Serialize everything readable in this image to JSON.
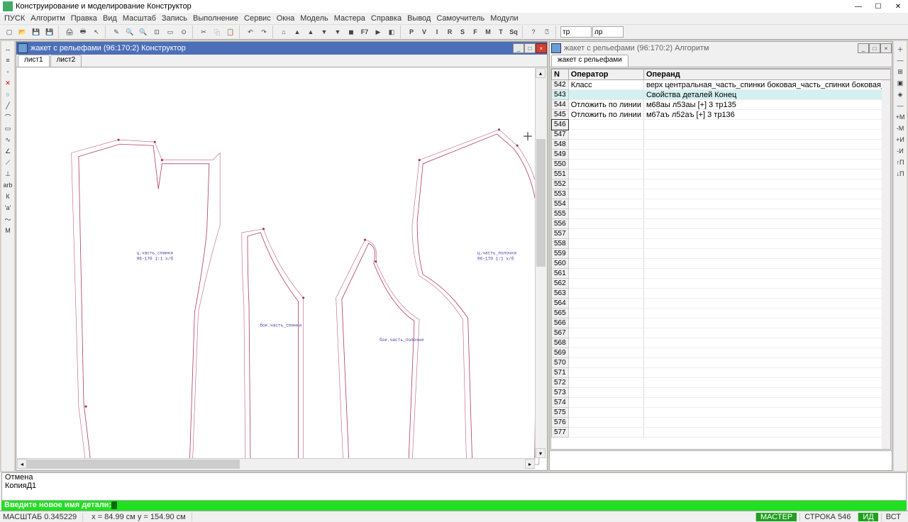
{
  "title": "Конструирование и моделирование  Конструктор",
  "menu": [
    "ПУСК",
    "Алгоритм",
    "Правка",
    "Вид",
    "Масштаб",
    "Запись",
    "Выполнение",
    "Сервис",
    "Окна",
    "Модель",
    "Мастера",
    "Справка",
    "Вывод",
    "Самоучитель",
    "Модули"
  ],
  "toolbar_inputs": {
    "a": "тр",
    "b": "лр"
  },
  "toolbar_letters": [
    "P",
    "V",
    "I",
    "R",
    "S",
    "F",
    "M",
    "T",
    "Sq"
  ],
  "panes": {
    "constructor": {
      "title": "жакет с рельефами (96:170:2) Конструктор",
      "tabs": [
        "лист1",
        "лист2"
      ],
      "active_tab": 0
    },
    "algorithm": {
      "title": "жакет с рельефами (96:170:2) Алгоритм",
      "tabs": [
        "жакет с рельефами"
      ]
    }
  },
  "table": {
    "headers": {
      "n": "N",
      "op": "Оператор",
      "operand": "Операнд"
    },
    "rows": [
      {
        "n": 542,
        "op": "Класс",
        "operand": "верх центральная_часть_спинки боковая_часть_спинки боковая_часть_полочки центральная_часть_полочки верхняя_часть_рукава нижняя_часть_рукава"
      },
      {
        "n": 543,
        "op": "",
        "operand": "Свойства деталей Конец",
        "highlight": true,
        "prefix": "$"
      },
      {
        "n": 544,
        "op": "Отложить по линии",
        "operand": "м68аы л53аы [+] 3 тр135"
      },
      {
        "n": 545,
        "op": "Отложить по линии",
        "operand": "м67аъ л52аъ [+] 3 тр136"
      },
      {
        "n": 546,
        "op": "",
        "operand": "",
        "selected": true
      },
      {
        "n": 547
      },
      {
        "n": 548
      },
      {
        "n": 549
      },
      {
        "n": 550
      },
      {
        "n": 551
      },
      {
        "n": 552
      },
      {
        "n": 553
      },
      {
        "n": 554
      },
      {
        "n": 555
      },
      {
        "n": 556
      },
      {
        "n": 557
      },
      {
        "n": 558
      },
      {
        "n": 559
      },
      {
        "n": 560
      },
      {
        "n": 561
      },
      {
        "n": 562
      },
      {
        "n": 563
      },
      {
        "n": 564
      },
      {
        "n": 565
      },
      {
        "n": 566
      },
      {
        "n": 567
      },
      {
        "n": 568
      },
      {
        "n": 569
      },
      {
        "n": 570
      },
      {
        "n": 571
      },
      {
        "n": 572
      },
      {
        "n": 573
      },
      {
        "n": 574
      },
      {
        "n": 575
      },
      {
        "n": 576
      },
      {
        "n": 577
      }
    ]
  },
  "log": {
    "l1": "Отмена",
    "l2": "КопияД1"
  },
  "prompt": "Введите новое имя детали:",
  "status": {
    "scale": "МАСШТАБ 0.345229",
    "coords": "x = 84.99 см    y = 154.90 см",
    "master": "МАСТЕР",
    "row": "СТРОКА 546",
    "id": "ИД",
    "vst": "ВСТ"
  }
}
